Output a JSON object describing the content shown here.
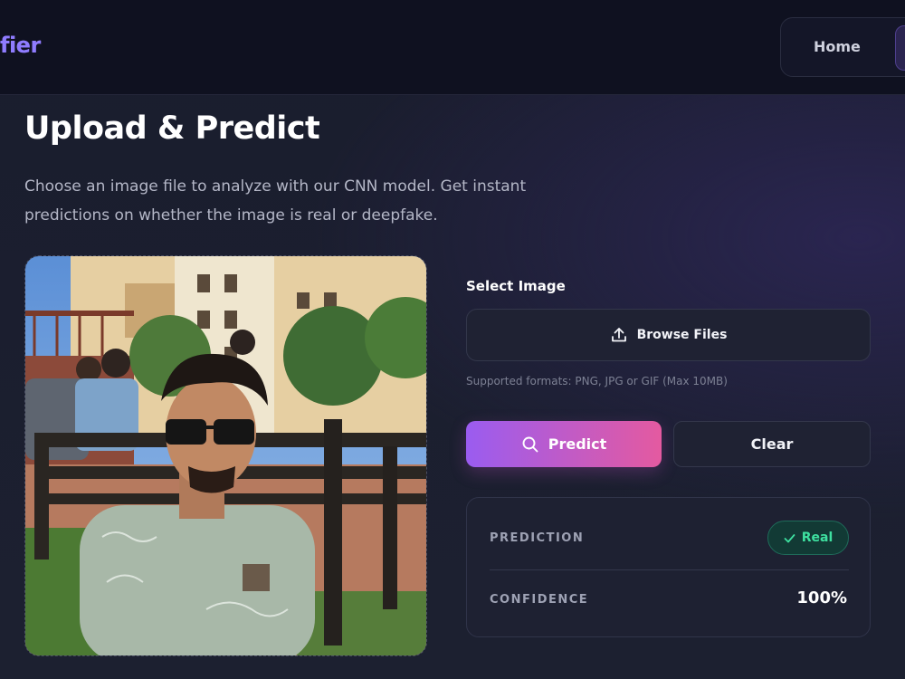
{
  "nav": {
    "brand": "fier",
    "home_label": "Home"
  },
  "page": {
    "title": "Upload & Predict",
    "subtitle": "Choose an image file to analyze with our CNN model. Get instant predictions on whether the image is real or deepfake."
  },
  "upload": {
    "select_label": "Select Image",
    "browse_label": "Browse Files",
    "formats_hint": "Supported formats: PNG, JPG or GIF (Max 10MB)",
    "icon": "upload-icon"
  },
  "actions": {
    "predict_label": "Predict",
    "predict_icon": "search-icon",
    "clear_label": "Clear"
  },
  "result": {
    "prediction_label": "PREDICTION",
    "prediction_value": "Real",
    "prediction_icon": "check-icon",
    "confidence_label": "CONFIDENCE",
    "confidence_value": "100%"
  },
  "colors": {
    "accent_start": "#9a5cf0",
    "accent_end": "#e45aa0",
    "success": "#3ee0a0",
    "brand": "#8f7cff"
  }
}
